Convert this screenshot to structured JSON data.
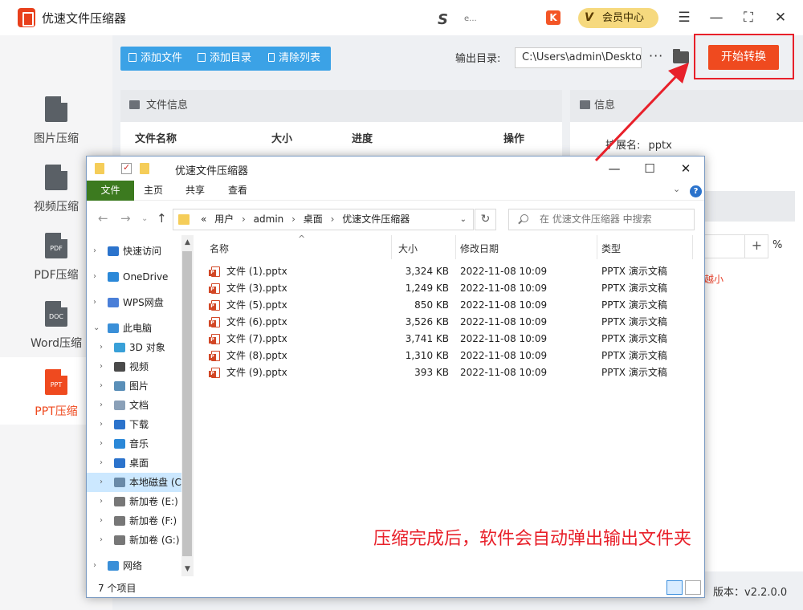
{
  "app": {
    "title": "优速文件压缩器",
    "s_logo": "S",
    "s_logo_text": "e...",
    "k_icon": "K",
    "vip_v": "V",
    "vip_label": "会员中心",
    "controls": [
      "☰",
      "—",
      "⛶",
      "✕"
    ]
  },
  "sidebar": {
    "items": [
      {
        "label": "图片压缩",
        "icon_text": ""
      },
      {
        "label": "视频压缩",
        "icon_text": ""
      },
      {
        "label": "PDF压缩",
        "icon_text": "PDF"
      },
      {
        "label": "Word压缩",
        "icon_text": "DOC"
      },
      {
        "label": "PPT压缩",
        "icon_text": "PPT",
        "active": true
      }
    ]
  },
  "toolbar": {
    "add_file": "添加文件",
    "add_dir": "添加目录",
    "clear_list": "清除列表",
    "output_label": "输出目录:",
    "output_path": "C:\\Users\\admin\\Desktop",
    "more": "···",
    "start": "开始转换"
  },
  "file_panel": {
    "title": "文件信息",
    "columns": [
      "文件名称",
      "大小",
      "进度",
      "操作"
    ]
  },
  "info_panel": {
    "title": "信息",
    "ext_label": "扩展名:",
    "ext_value": "pptx",
    "pct_plus": "+",
    "pct_sign": "%",
    "hint": "越小"
  },
  "version_text": "版本：v2.2.0.0",
  "explorer": {
    "title": "优速文件压缩器",
    "controls": [
      "—",
      "☐",
      "✕"
    ],
    "ribbon": [
      "文件",
      "主页",
      "共享",
      "查看"
    ],
    "help": "?",
    "ribbon_chev": "⌄",
    "nav_back": "←",
    "nav_fwd": "→",
    "nav_dd": "⌄",
    "nav_up": "↑",
    "address": [
      "«",
      "用户",
      "›",
      "admin",
      "›",
      "桌面",
      "›",
      "优速文件压缩器"
    ],
    "address_dd": "⌄",
    "refresh": "↻",
    "search_placeholder": "在 优速文件压缩器 中搜索",
    "nav_items": [
      {
        "label": "快速访问",
        "color": "#2b73cc",
        "indent": 0,
        "chev": "›"
      },
      {
        "label": "OneDrive",
        "color": "#2b88d8",
        "indent": 0,
        "chev": "›"
      },
      {
        "label": "WPS网盘",
        "color": "#4a7fd8",
        "indent": 0,
        "chev": "›"
      },
      {
        "label": "此电脑",
        "color": "#3a8fd8",
        "indent": 0,
        "chev": "⌄"
      },
      {
        "label": "3D 对象",
        "color": "#39a0d8",
        "indent": 1,
        "chev": "›"
      },
      {
        "label": "视频",
        "color": "#4a4a4a",
        "indent": 1,
        "chev": "›"
      },
      {
        "label": "图片",
        "color": "#5a8fb8",
        "indent": 1,
        "chev": "›"
      },
      {
        "label": "文档",
        "color": "#8aa0b8",
        "indent": 1,
        "chev": "›"
      },
      {
        "label": "下载",
        "color": "#2b73cc",
        "indent": 1,
        "chev": "›"
      },
      {
        "label": "音乐",
        "color": "#2b88d8",
        "indent": 1,
        "chev": "›"
      },
      {
        "label": "桌面",
        "color": "#2b73cc",
        "indent": 1,
        "chev": "›"
      },
      {
        "label": "本地磁盘 (C:)",
        "color": "#6a8aa8",
        "indent": 1,
        "chev": "›",
        "selected": true
      },
      {
        "label": "新加卷 (E:)",
        "color": "#777777",
        "indent": 1,
        "chev": "›"
      },
      {
        "label": "新加卷 (F:)",
        "color": "#777777",
        "indent": 1,
        "chev": "›"
      },
      {
        "label": "新加卷 (G:)",
        "color": "#777777",
        "indent": 1,
        "chev": "›"
      },
      {
        "label": "网络",
        "color": "#3a8fd8",
        "indent": 0,
        "chev": "›"
      }
    ],
    "scroll_up": "▲",
    "scroll_down": "▼",
    "columns": {
      "sort_arrow": "^",
      "name": "名称",
      "size": "大小",
      "date": "修改日期",
      "type": "类型"
    },
    "files": [
      {
        "name": "文件 (1).pptx",
        "size": "3,324 KB",
        "date": "2022-11-08 10:09",
        "type": "PPTX 演示文稿"
      },
      {
        "name": "文件 (3).pptx",
        "size": "1,249 KB",
        "date": "2022-11-08 10:09",
        "type": "PPTX 演示文稿"
      },
      {
        "name": "文件 (5).pptx",
        "size": "850 KB",
        "date": "2022-11-08 10:09",
        "type": "PPTX 演示文稿"
      },
      {
        "name": "文件 (6).pptx",
        "size": "3,526 KB",
        "date": "2022-11-08 10:09",
        "type": "PPTX 演示文稿"
      },
      {
        "name": "文件 (7).pptx",
        "size": "3,741 KB",
        "date": "2022-11-08 10:09",
        "type": "PPTX 演示文稿"
      },
      {
        "name": "文件 (8).pptx",
        "size": "1,310 KB",
        "date": "2022-11-08 10:09",
        "type": "PPTX 演示文稿"
      },
      {
        "name": "文件 (9).pptx",
        "size": "393 KB",
        "date": "2022-11-08 10:09",
        "type": "PPTX 演示文稿"
      }
    ],
    "status": "7 个项目"
  },
  "annotation": "压缩完成后，软件会自动弹出输出文件夹",
  "colors": {
    "accent": "#ef4a1f",
    "blue": "#3ba2e6",
    "annot_red": "#e8202a"
  }
}
